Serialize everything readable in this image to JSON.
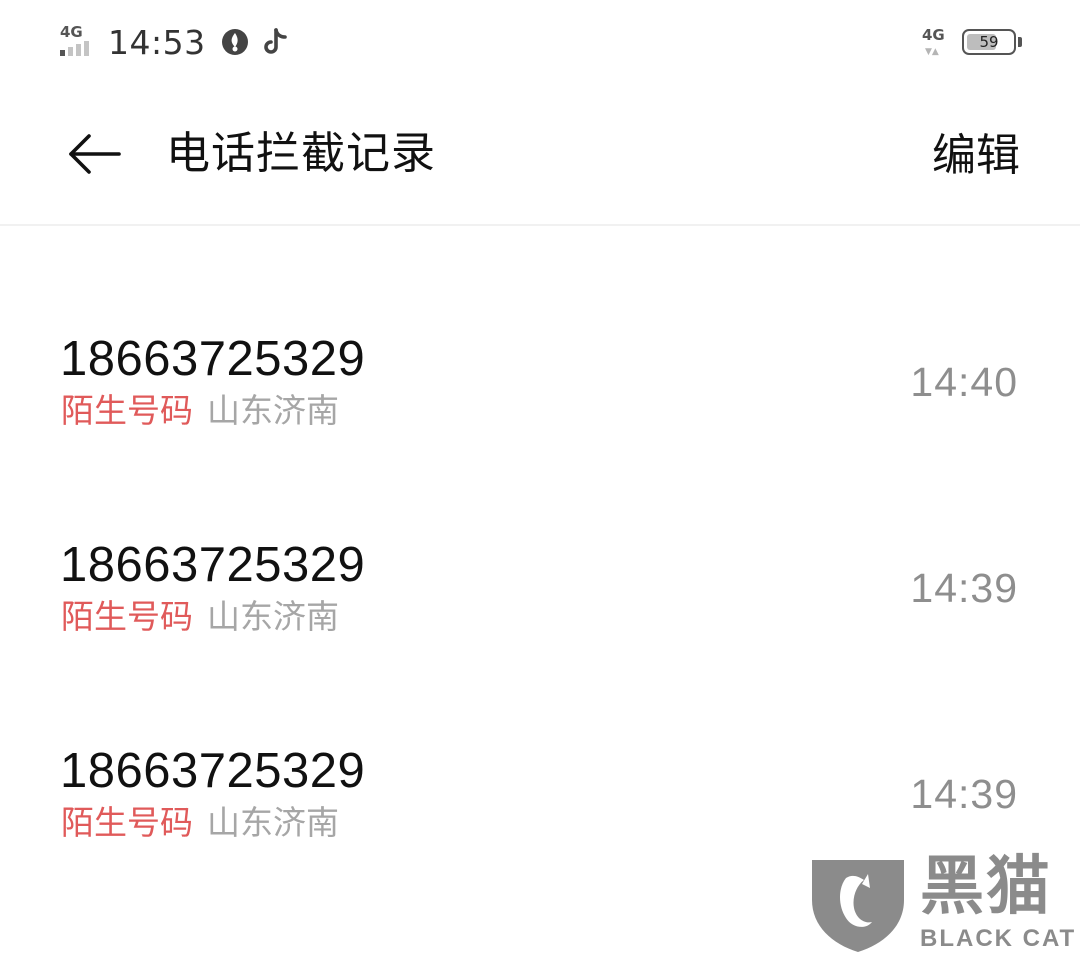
{
  "status_bar": {
    "left_network": "4G",
    "time": "14:53",
    "right_network": "4G",
    "battery_level": "59",
    "icons": [
      "signal-icon",
      "browser-icon",
      "tiktok-icon",
      "network-icon",
      "battery-icon"
    ]
  },
  "header": {
    "title": "电话拦截记录",
    "edit_label": "编辑",
    "back_icon": "back-arrow-icon"
  },
  "calls": [
    {
      "number": "18663725329",
      "type": "陌生号码",
      "location": "山东济南",
      "time": "14:40"
    },
    {
      "number": "18663725329",
      "type": "陌生号码",
      "location": "山东济南",
      "time": "14:39"
    },
    {
      "number": "18663725329",
      "type": "陌生号码",
      "location": "山东济南",
      "time": "14:39"
    }
  ],
  "watermark": {
    "brand": "黑猫",
    "brand_en": "BLACK CAT"
  },
  "colors": {
    "tag_red": "#e05a5a",
    "muted_gray": "#a6a6a6",
    "time_gray": "#8e8e8e"
  }
}
